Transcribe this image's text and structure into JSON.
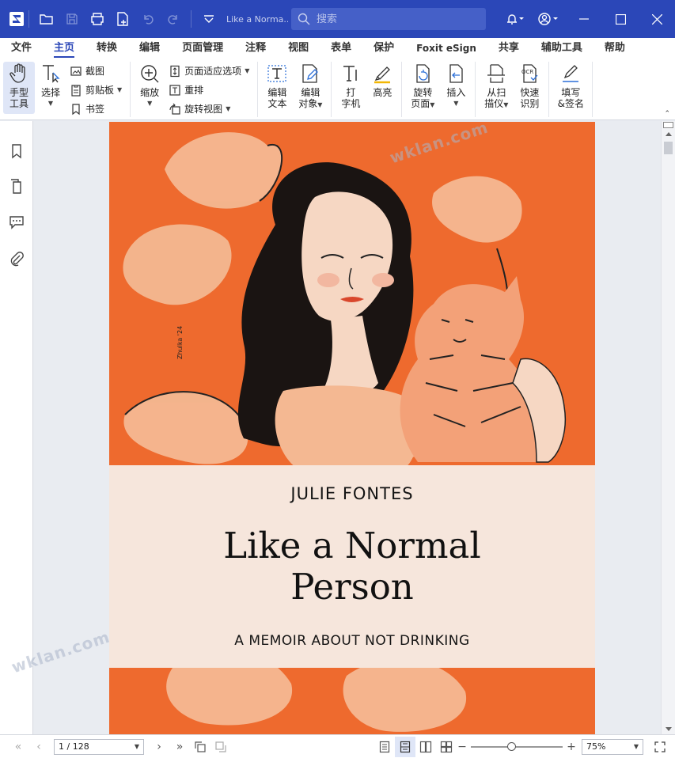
{
  "titlebar": {
    "doc_title": "Like a Norma...",
    "search_placeholder": "搜索"
  },
  "menu": [
    "文件",
    "主页",
    "转换",
    "编辑",
    "页面管理",
    "注释",
    "视图",
    "表单",
    "保护",
    "Foxit eSign",
    "共享",
    "辅助工具",
    "帮助"
  ],
  "ribbon": {
    "hand_tool": "手型\n工具",
    "select": "选择",
    "screenshot": "截图",
    "clipboard": "剪贴板",
    "bookmark": "书签",
    "zoom": "缩放",
    "page_fit": "页面适应选项",
    "reflow": "重排",
    "rotate_view": "旋转视图",
    "edit_text": "编辑\n文本",
    "edit_object": "编辑\n对象",
    "typewriter": "打\n字机",
    "highlight": "高亮",
    "rotate_page": "旋转\n页面",
    "insert": "插入",
    "from_scanner": "从扫\n描仪",
    "quick_ocr": "快速\n识别",
    "fill_sign": "填写\n&签名"
  },
  "book": {
    "author": "JULIE FONTES",
    "title_line1": "Like a Normal",
    "title_line2": "Person",
    "subtitle": "A MEMOIR ABOUT NOT DRINKING",
    "signature": "Zhulka '24",
    "bg_color": "#ee6a2e",
    "band_color": "#f6e6dc"
  },
  "status": {
    "page_indicator": "1 / 128",
    "zoom": "75%"
  },
  "watermark": "wklan.com"
}
